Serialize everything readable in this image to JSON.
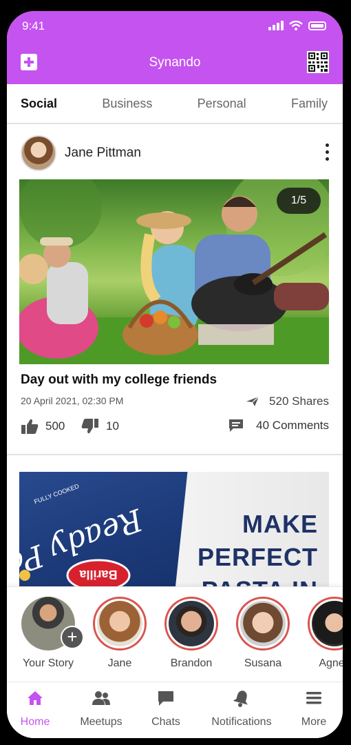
{
  "status": {
    "time": "9:41"
  },
  "app": {
    "title": "Synando",
    "accent": "#c553f0"
  },
  "tabs": [
    {
      "label": "Social",
      "active": true
    },
    {
      "label": "Business",
      "active": false
    },
    {
      "label": "Personal",
      "active": false
    },
    {
      "label": "Family",
      "active": false
    }
  ],
  "post": {
    "author": "Jane Pittman",
    "image_counter": "1/5",
    "title": "Day out with my college friends",
    "date": "20 April 2021, 02:30 PM",
    "shares": "520 Shares",
    "likes": "500",
    "dislikes": "10",
    "comments": "40 Comments"
  },
  "ad": {
    "brand": "Barilla",
    "pack_text": "Ready Pasta",
    "pack_subtext": "FULLY COOKED",
    "headline_1": "MAKE",
    "headline_2": "PERFECT",
    "headline_3": "PASTA IN"
  },
  "stories": [
    {
      "name": "Your Story",
      "own": true
    },
    {
      "name": "Jane"
    },
    {
      "name": "Brandon"
    },
    {
      "name": "Susana"
    },
    {
      "name": "Agnes"
    }
  ],
  "nav": [
    {
      "label": "Home",
      "icon": "home-icon",
      "active": true
    },
    {
      "label": "Meetups",
      "icon": "people-icon"
    },
    {
      "label": "Chats",
      "icon": "chat-icon"
    },
    {
      "label": "Notifications",
      "icon": "bell-icon"
    },
    {
      "label": "More",
      "icon": "menu-icon"
    }
  ]
}
